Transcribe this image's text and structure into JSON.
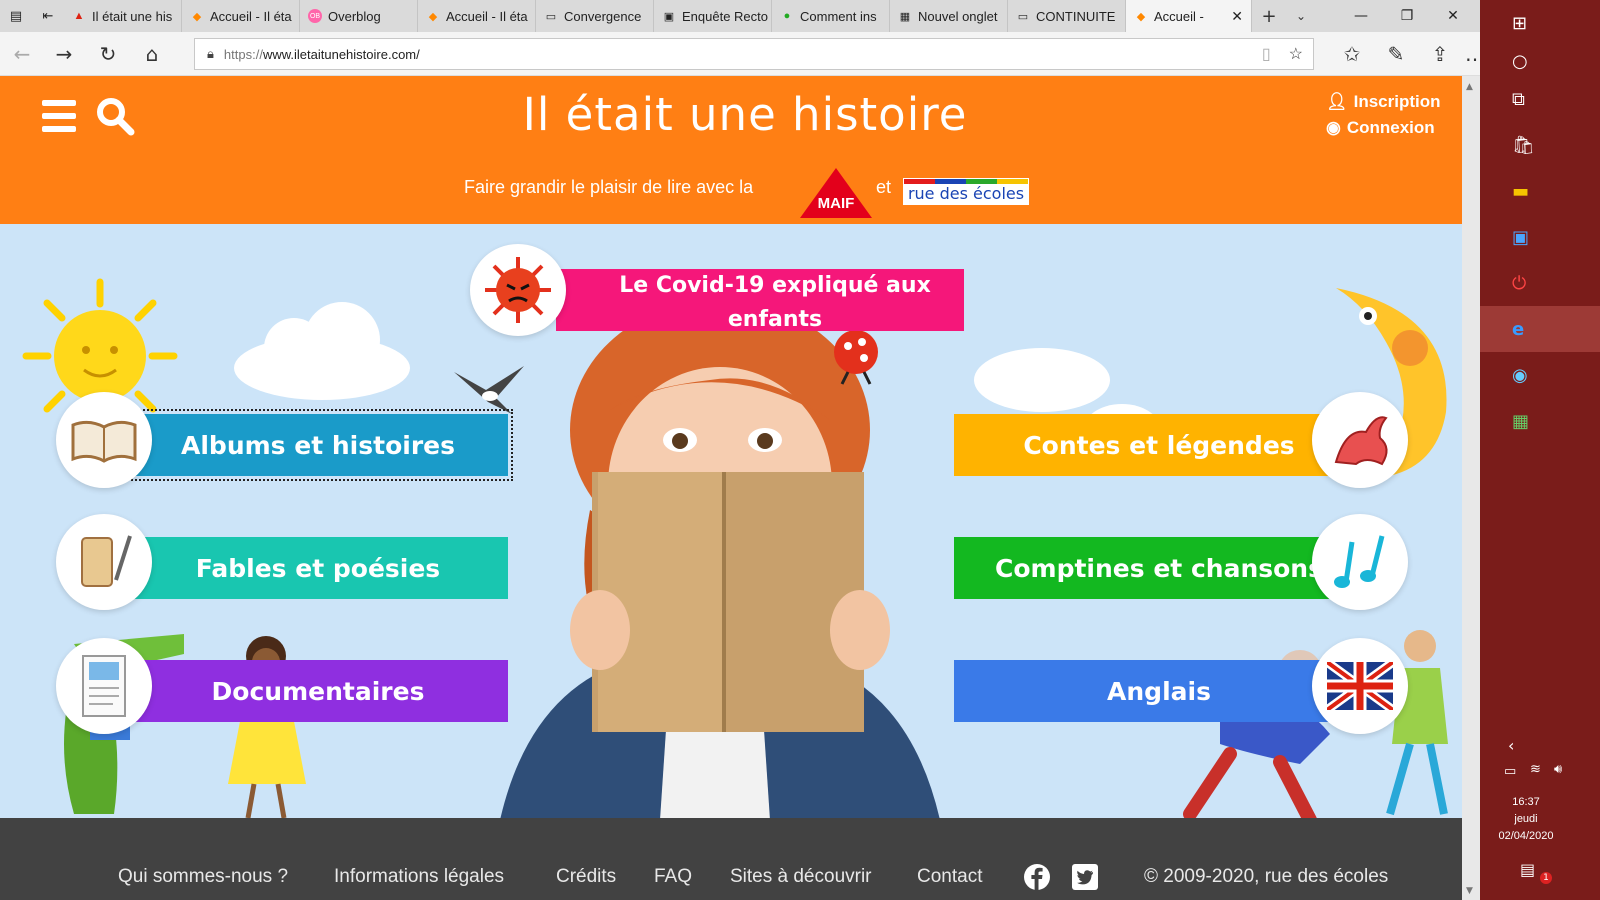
{
  "browser": {
    "tabs": [
      {
        "label": "Il était une his",
        "favicon": "red-logo-icon"
      },
      {
        "label": "Accueil - Il éta",
        "favicon": "orange-book-icon"
      },
      {
        "label": "Overblog",
        "favicon": "ob-icon"
      },
      {
        "label": "Accueil - Il éta",
        "favicon": "orange-book-icon"
      },
      {
        "label": "Convergence",
        "favicon": "page-icon"
      },
      {
        "label": "Enquête Recto",
        "favicon": "image-icon"
      },
      {
        "label": "Comment ins",
        "favicon": "green-circle-icon"
      },
      {
        "label": "Nouvel onglet",
        "favicon": "grid-icon"
      },
      {
        "label": "CONTINUITE",
        "favicon": "page-icon"
      }
    ],
    "active_tab": {
      "label": "Accueil -",
      "favicon": "orange-book-icon"
    },
    "url_prefix": "https://",
    "url_host": "www.iletaitunehistoire.com/"
  },
  "site": {
    "title": "Il était une histoire",
    "signup": "Inscription",
    "login": "Connexion",
    "tagline": "Faire grandir le plaisir de lire avec la",
    "tagline_and": "et",
    "maif": "MAIF",
    "rue_des_ecoles": "rue des écoles"
  },
  "hero": {
    "covid_line1": "Le Covid-19 expliqué aux",
    "covid_line2": "enfants",
    "categories_left": [
      {
        "label": "Albums et histoires",
        "color": "#1a9bc9"
      },
      {
        "label": "Fables et poésies",
        "color": "#19c6b0"
      },
      {
        "label": "Documentaires",
        "color": "#8f2fe0"
      }
    ],
    "categories_right": [
      {
        "label": "Contes et légendes",
        "color": "#ffb300"
      },
      {
        "label": "Comptines et chansons",
        "color": "#13b820"
      },
      {
        "label": "Anglais",
        "color": "#3a7ae8"
      }
    ]
  },
  "footer": {
    "links": [
      "Qui sommes-nous ?",
      "Informations légales",
      "Crédits",
      "FAQ",
      "Sites à découvrir",
      "Contact"
    ],
    "copyright": "© 2009-2020, rue des écoles"
  },
  "taskbar": {
    "time": "16:37",
    "day": "jeudi",
    "date": "02/04/2020",
    "notif_count": "1"
  },
  "colors": {
    "header": "#ff7f14",
    "hero_bg": "#cce4f8",
    "footer": "#424242",
    "taskbar": "#7a1c1a"
  }
}
